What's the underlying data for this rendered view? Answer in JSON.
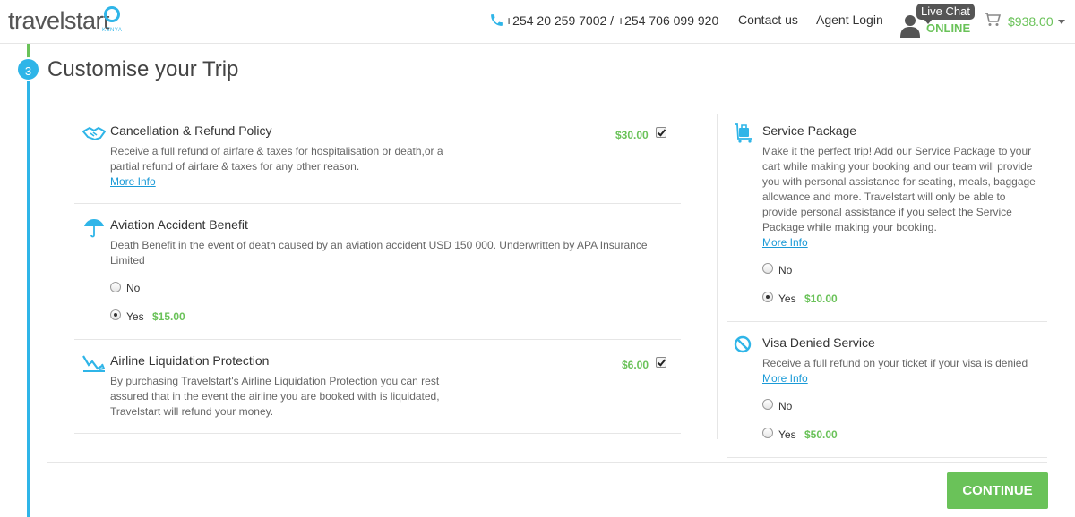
{
  "header": {
    "logo_text": "travelstart",
    "logo_country": "KENYA",
    "phone": "+254 20 259 7002 / +254 706 099 920",
    "contact_label": "Contact us",
    "agent_login_label": "Agent Login",
    "live_chat_label": "Live Chat",
    "live_chat_status": "ONLINE",
    "cart_amount": "$938.00"
  },
  "step": {
    "number": "3",
    "title": "Customise your Trip"
  },
  "left_items": {
    "cancellation": {
      "title": "Cancellation & Refund Policy",
      "desc_line1": "Receive a full refund of airfare & taxes for hospitalisation or death,or a",
      "desc_line2": "partial refund of airfare & taxes for any other reason.",
      "more_info": "More Info",
      "price": "$30.00",
      "checked": true
    },
    "aviation": {
      "title": "Aviation Accident Benefit",
      "desc_line1": "Death Benefit in the event of death caused by an aviation accident USD 150 000. Underwritten by APA Insurance",
      "desc_line2": "Limited",
      "option_no": "No",
      "option_yes": "Yes",
      "yes_price": "$15.00",
      "selected": "Yes"
    },
    "liquidation": {
      "title": "Airline Liquidation Protection",
      "desc_line1": "By purchasing Travelstart's Airline Liquidation Protection you can rest",
      "desc_line2": "assured that in the event the airline you are booked with is liquidated,",
      "desc_line3": "Travelstart will refund your money.",
      "price": "$6.00",
      "checked": true
    }
  },
  "right_items": {
    "service": {
      "title": "Service Package",
      "desc_lines": [
        "Make it the perfect trip! Add our Service Package to your",
        "cart while making your booking and our team will provide",
        "you with personal assistance for seating, meals, baggage",
        "allowance and more. Travelstart will only be able to",
        "provide personal assistance if you select the Service",
        "Package while making your booking."
      ],
      "more_info": "More Info",
      "option_no": "No",
      "option_yes": "Yes",
      "yes_price": "$10.00",
      "selected": "Yes"
    },
    "visa": {
      "title": "Visa Denied Service",
      "desc": "Receive a full refund on your ticket if your visa is denied",
      "more_info": "More Info",
      "option_no": "No",
      "option_yes": "Yes",
      "yes_price": "$50.00",
      "selected": "None"
    }
  },
  "continue_label": "CONTINUE",
  "colors": {
    "accent_blue": "#2fb5e8",
    "accent_green": "#6ac259",
    "link": "#1a9ad7"
  },
  "icons": [
    "phone-icon",
    "agent-icon",
    "cart-icon",
    "handshake-icon",
    "umbrella-icon",
    "chart-down-icon",
    "luggage-cart-icon",
    "no-entry-icon"
  ]
}
